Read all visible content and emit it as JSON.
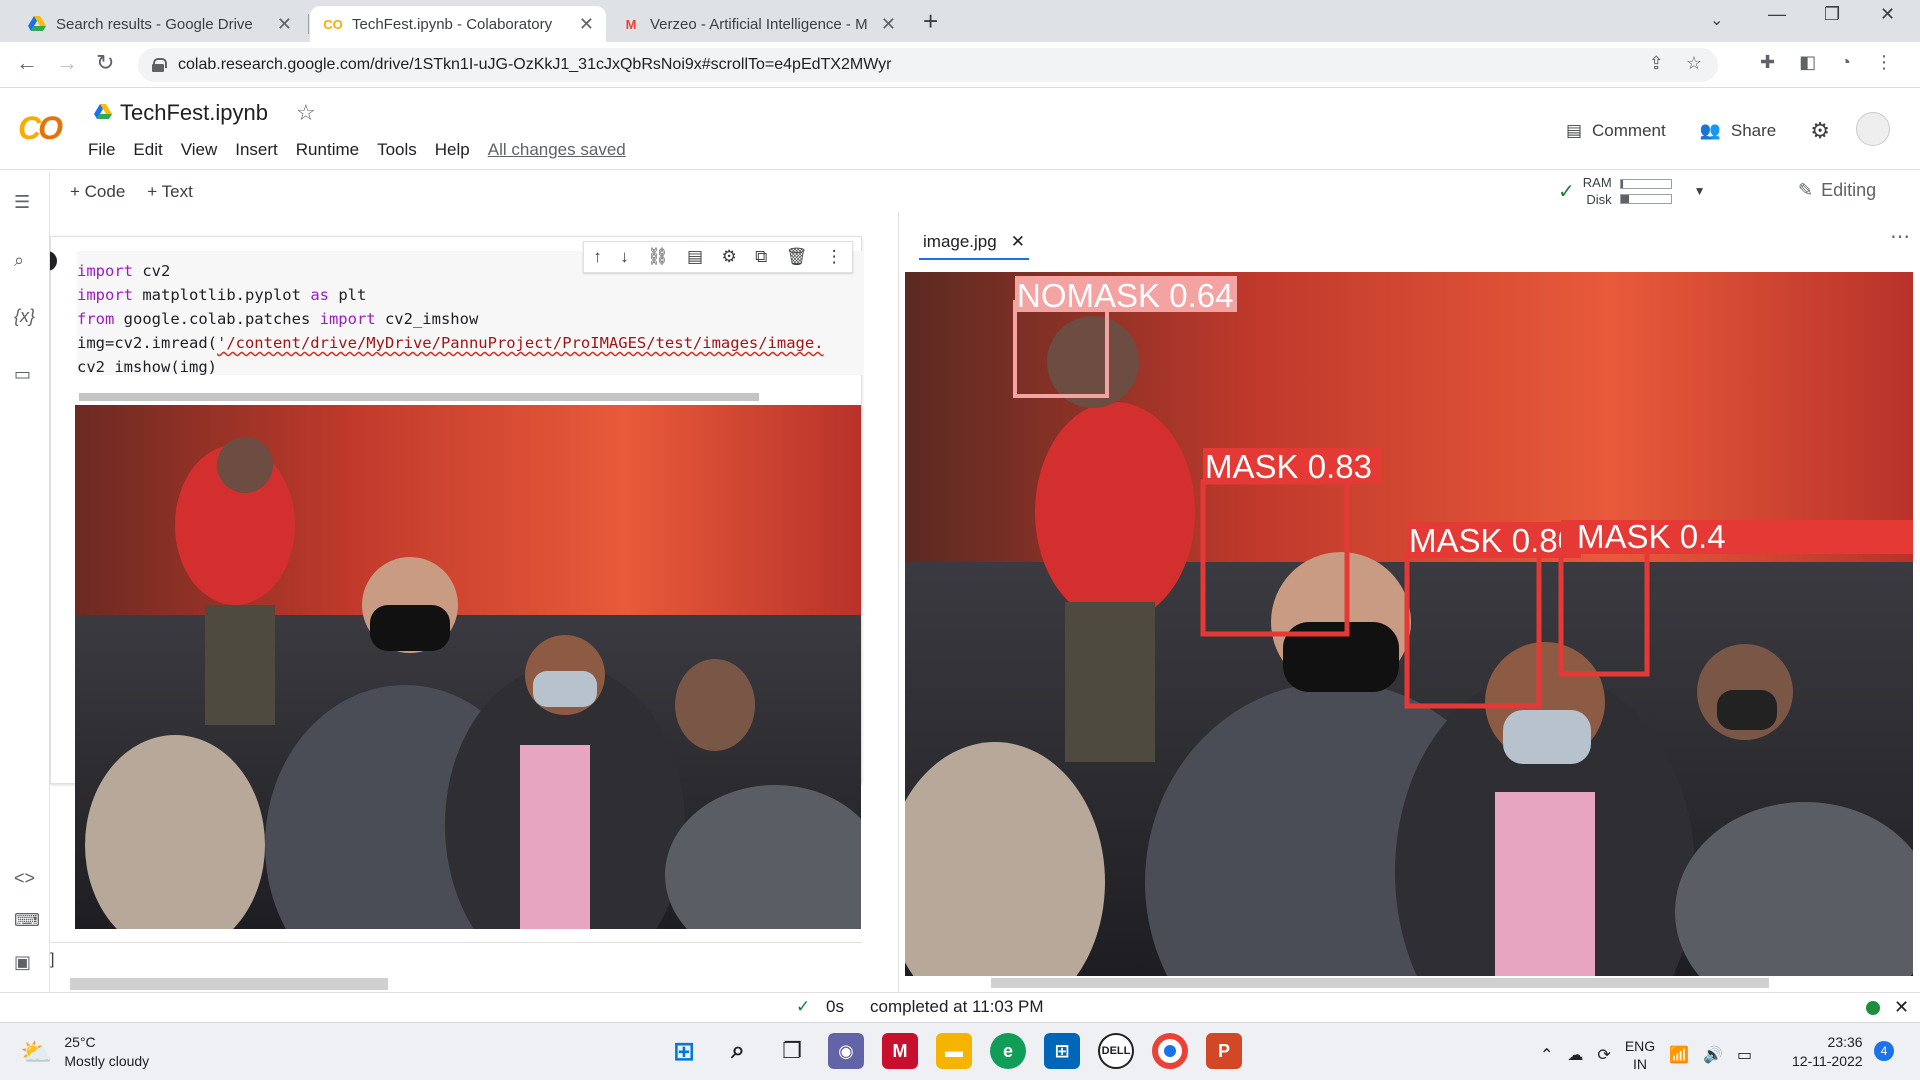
{
  "browser": {
    "tabs": [
      {
        "title": "Search results - Google Drive",
        "active": false
      },
      {
        "title": "TechFest.ipynb - Colaboratory",
        "active": true
      },
      {
        "title": "Verzeo - Artificial Intelligence - M",
        "active": false
      }
    ],
    "url": "colab.research.google.com/drive/1STkn1I-uJG-OzKkJ1_31cJxQbRsNoi9x#scrollTo=e4pEdTX2MWyr"
  },
  "colab": {
    "notebook_title": "TechFest.ipynb",
    "menu": [
      "File",
      "Edit",
      "View",
      "Insert",
      "Runtime",
      "Tools",
      "Help"
    ],
    "saved_status": "All changes saved",
    "comment_label": "Comment",
    "share_label": "Share",
    "add_code_label": "+ Code",
    "add_text_label": "+ Text",
    "ram_label": "RAM",
    "disk_label": "Disk",
    "ram_usage": 0.04,
    "disk_usage": 0.16,
    "editing_label": "Editing"
  },
  "cell": {
    "code_lines": [
      {
        "kw": "import",
        "rest": " cv2"
      },
      {
        "kw": "import",
        "rest": " matplotlib.pyplot ",
        "kw2": "as",
        "rest2": " plt"
      },
      {
        "kw": "from",
        "rest": " google.colab.patches ",
        "kw2": "import",
        "rest2": " cv2_imshow"
      },
      {
        "pre": "img=cv2.imread(",
        "str": "'/content/drive/MyDrive/PannuProject/ProIMAGES/test/images/image."
      },
      {
        "pre": "cv2_imshow(img)"
      }
    ]
  },
  "viewer": {
    "tab_title": "image.jpg",
    "detections": [
      {
        "label": "NOMASK 0.64"
      },
      {
        "label": "MASK 0.83"
      },
      {
        "label": "MASK 0.80"
      },
      {
        "label": "MASK 0.4"
      }
    ]
  },
  "status": {
    "exec_time": "0s",
    "completed_text": "completed at 11:03 PM"
  },
  "taskbar": {
    "temperature": "25°C",
    "weather": "Mostly cloudy",
    "lang_top": "ENG",
    "lang_bottom": "IN",
    "time": "23:36",
    "date": "12-11-2022",
    "notification_count": "4"
  },
  "colors": {
    "accent": "#1a73e8",
    "detection_box": "#e53935",
    "nomask_box": "#f4a3a3",
    "keyword": "#9b1cc0"
  }
}
